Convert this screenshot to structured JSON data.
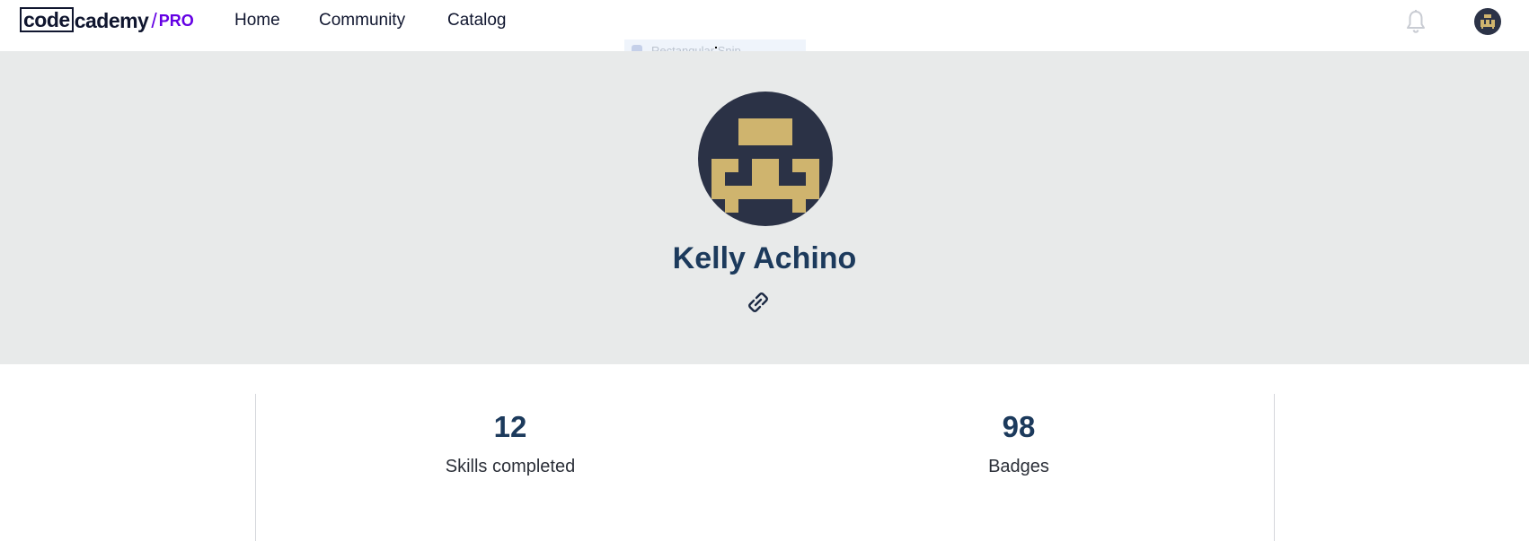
{
  "nav": {
    "logo": {
      "code": "code",
      "cademy": "cademy",
      "slash": "/",
      "pro": "PRO"
    },
    "links": [
      "Home",
      "Community",
      "Catalog"
    ],
    "icons": {
      "notifications": "bell-icon",
      "user": "user-avatar"
    }
  },
  "overlay": {
    "snip_label": "Rectangular Snip"
  },
  "profile": {
    "name": "Kelly Achino",
    "link_icon": "link-icon"
  },
  "stats": {
    "skills": {
      "value": "12",
      "label": "Skills completed"
    },
    "badges": {
      "value": "98",
      "label": "Badges"
    }
  },
  "colors": {
    "brand_dark": "#10162f",
    "pro_purple": "#6400e4",
    "hero_bg": "#e8eaea",
    "name_blue": "#1c3a5c",
    "avatar_bg": "#2b3246",
    "avatar_gold": "#cfb46e"
  }
}
